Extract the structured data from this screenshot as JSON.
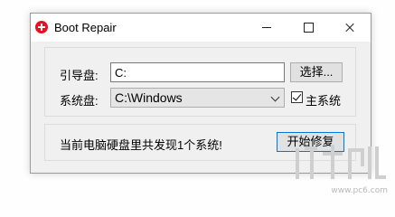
{
  "window": {
    "title": "Boot Repair"
  },
  "boot_disk": {
    "label": "引导盘:",
    "value": "C:",
    "browse_label": "选择..."
  },
  "system_disk": {
    "label": "系统盘:",
    "selected": "C:\\Windows",
    "main_system_label": "主系统",
    "main_system_checked": true
  },
  "status": {
    "message": "当前电脑硬盘里共发现1个系统!",
    "start_label": "开始修复"
  },
  "watermark": {
    "url": "www.pc6.com"
  },
  "colors": {
    "accent": "#0078d7",
    "icon_red": "#e81123"
  }
}
